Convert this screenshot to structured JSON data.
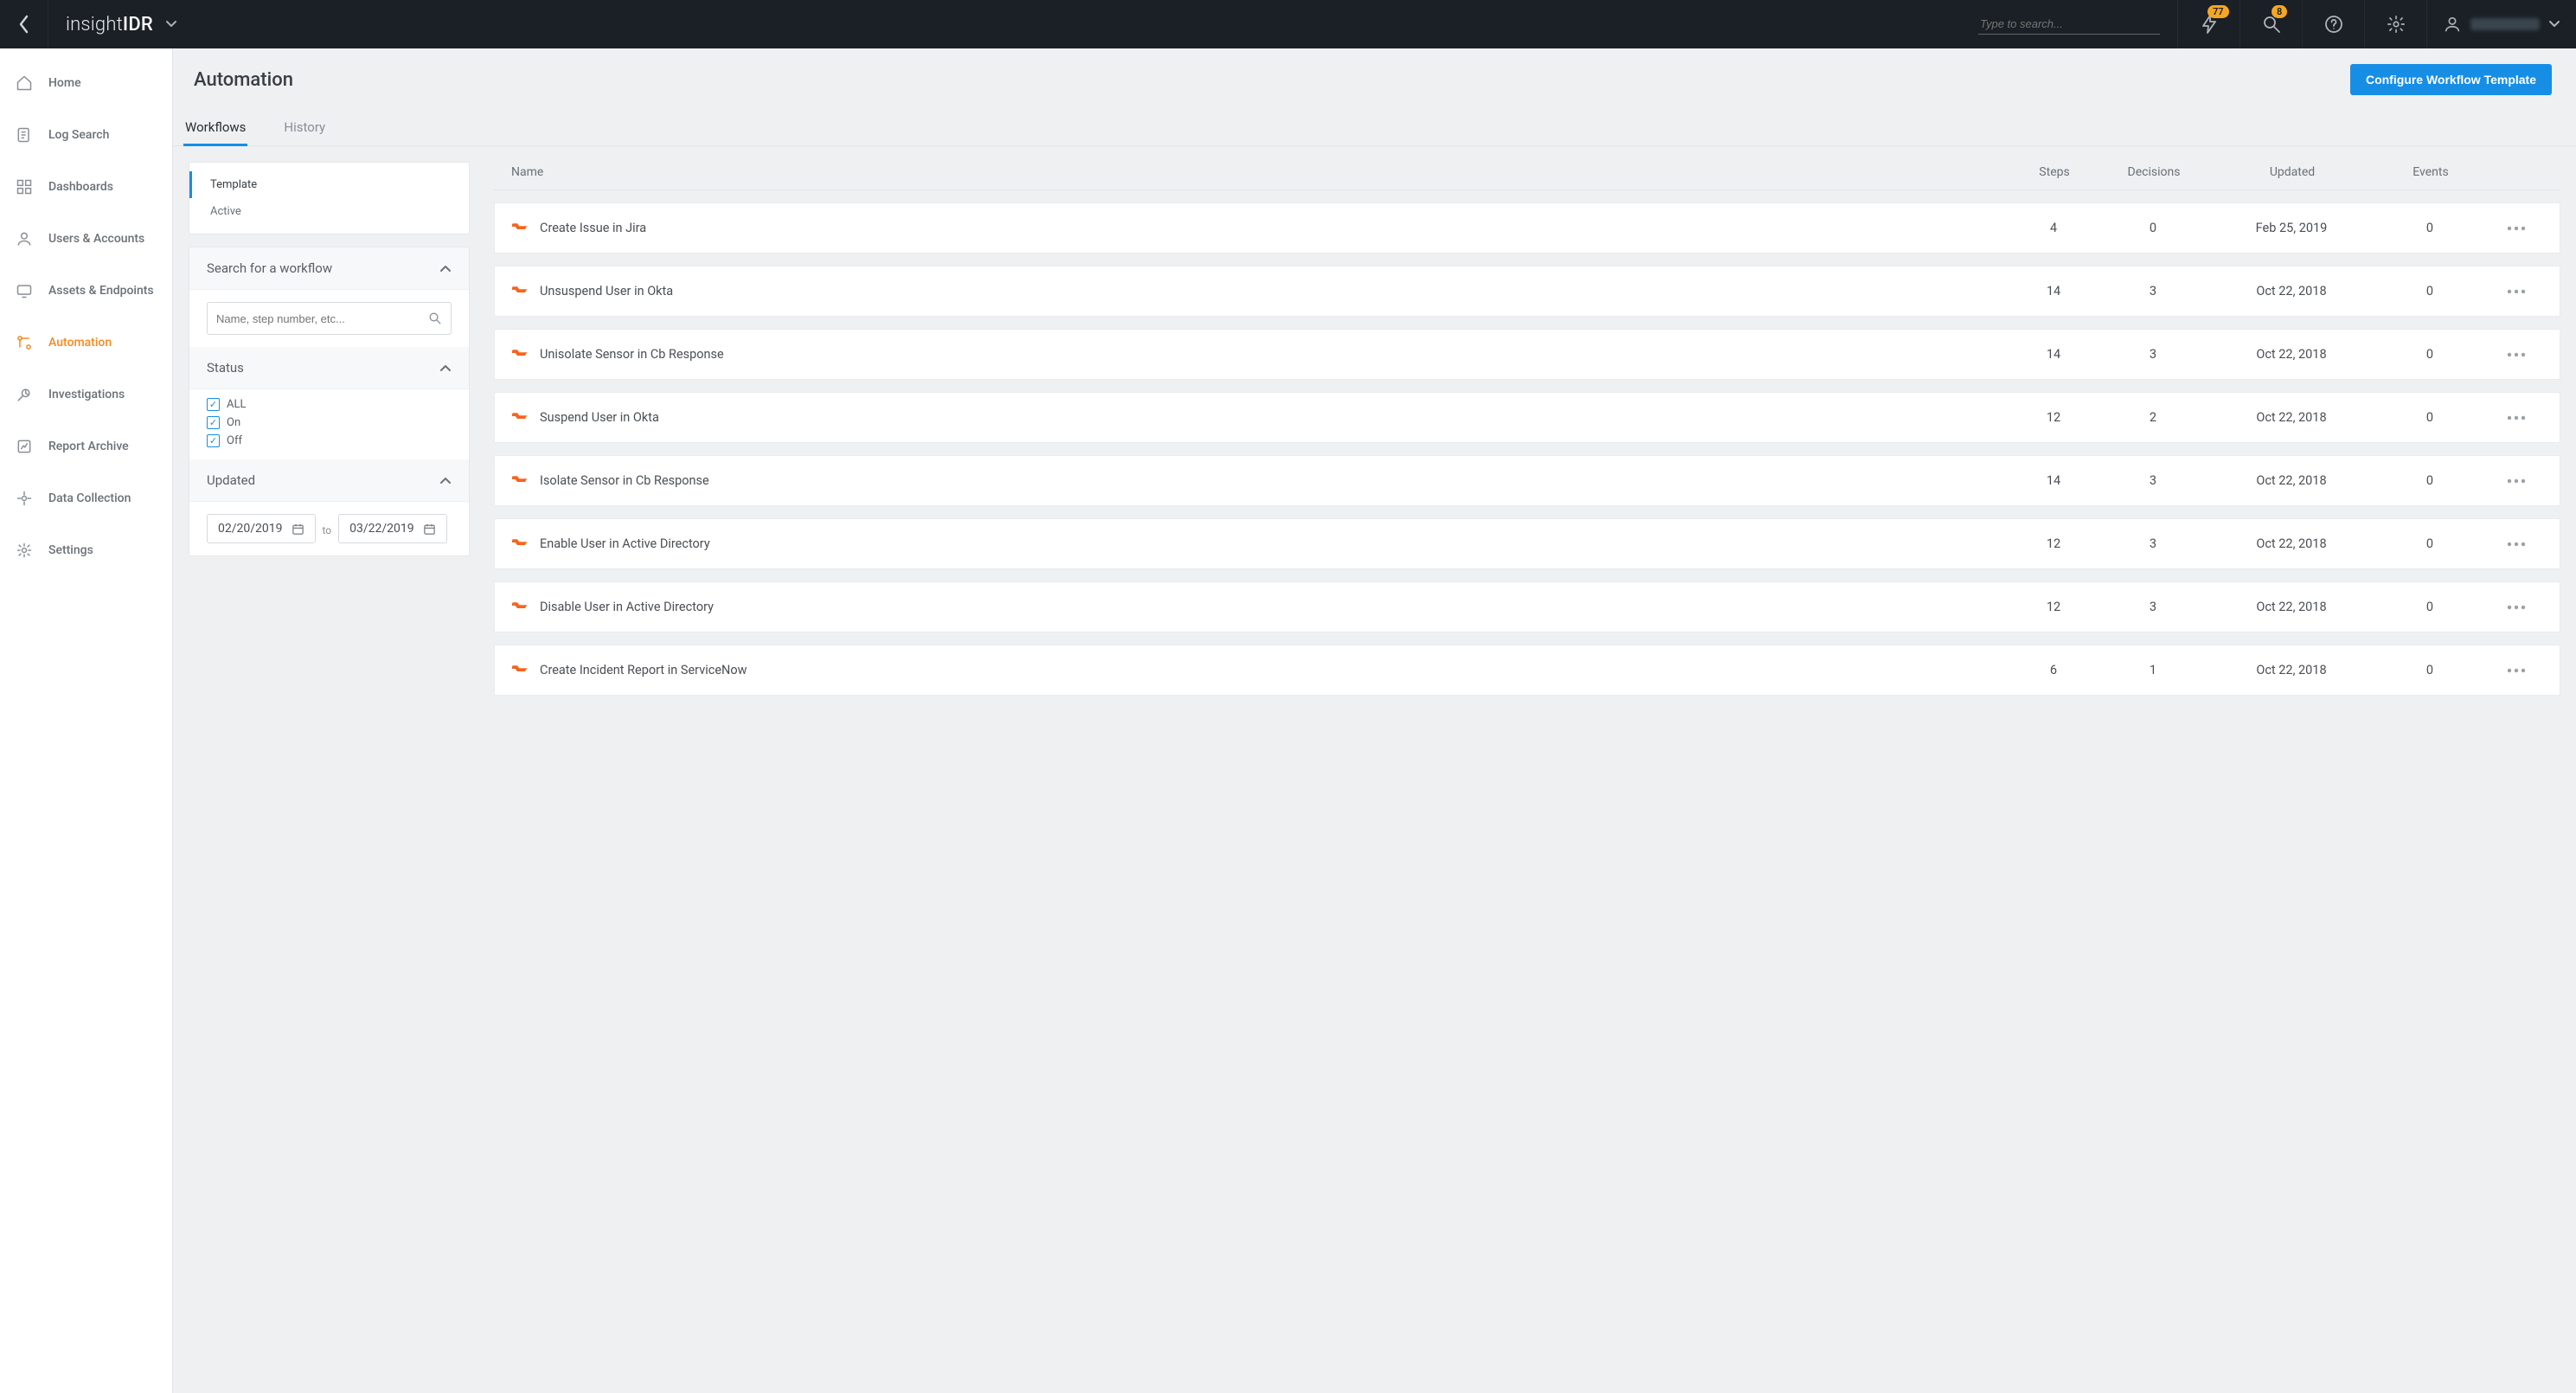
{
  "brand": {
    "light": "insight",
    "bold": "IDR"
  },
  "top_search_placeholder": "Type to search...",
  "top_badges": {
    "lightning": "77",
    "key": "8"
  },
  "sidebar": {
    "items": [
      {
        "label": "Home"
      },
      {
        "label": "Log Search"
      },
      {
        "label": "Dashboards"
      },
      {
        "label": "Users & Accounts"
      },
      {
        "label": "Assets & Endpoints"
      },
      {
        "label": "Automation"
      },
      {
        "label": "Investigations"
      },
      {
        "label": "Report Archive"
      },
      {
        "label": "Data Collection"
      },
      {
        "label": "Settings"
      }
    ],
    "active_index": 5
  },
  "page": {
    "title": "Automation",
    "cta": "Configure Workflow Template"
  },
  "tabs": {
    "items": [
      {
        "label": "Workflows"
      },
      {
        "label": "History"
      }
    ],
    "active_index": 0
  },
  "filter": {
    "subnav": {
      "items": [
        "Template",
        "Active"
      ],
      "active_index": 0
    },
    "search_section": {
      "title": "Search for a workflow",
      "placeholder": "Name, step number, etc..."
    },
    "status_section": {
      "title": "Status",
      "options": [
        {
          "label": "ALL",
          "checked": true
        },
        {
          "label": "On",
          "checked": true
        },
        {
          "label": "Off",
          "checked": true
        }
      ]
    },
    "updated_section": {
      "title": "Updated",
      "from": "02/20/2019",
      "to_label": "to",
      "to": "03/22/2019"
    }
  },
  "table": {
    "columns": {
      "name": "Name",
      "steps": "Steps",
      "decisions": "Decisions",
      "updated": "Updated",
      "events": "Events"
    },
    "rows": [
      {
        "name": "Create Issue in Jira",
        "steps": "4",
        "decisions": "0",
        "updated": "Feb 25, 2019",
        "events": "0"
      },
      {
        "name": "Unsuspend User in Okta",
        "steps": "14",
        "decisions": "3",
        "updated": "Oct 22, 2018",
        "events": "0"
      },
      {
        "name": "Unisolate Sensor in Cb Response",
        "steps": "14",
        "decisions": "3",
        "updated": "Oct 22, 2018",
        "events": "0"
      },
      {
        "name": "Suspend User in Okta",
        "steps": "12",
        "decisions": "2",
        "updated": "Oct 22, 2018",
        "events": "0"
      },
      {
        "name": "Isolate Sensor in Cb Response",
        "steps": "14",
        "decisions": "3",
        "updated": "Oct 22, 2018",
        "events": "0"
      },
      {
        "name": "Enable User in Active Directory",
        "steps": "12",
        "decisions": "3",
        "updated": "Oct 22, 2018",
        "events": "0"
      },
      {
        "name": "Disable User in Active Directory",
        "steps": "12",
        "decisions": "3",
        "updated": "Oct 22, 2018",
        "events": "0"
      },
      {
        "name": "Create Incident Report in ServiceNow",
        "steps": "6",
        "decisions": "1",
        "updated": "Oct 22, 2018",
        "events": "0"
      }
    ]
  }
}
